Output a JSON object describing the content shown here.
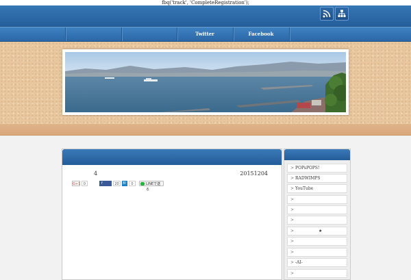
{
  "top_script_text": "fbq('track', 'CompleteRegistration');",
  "header": {
    "icons": [
      "rss-icon",
      "sitemap-icon"
    ]
  },
  "nav": {
    "items": [
      {
        "label": ""
      },
      {
        "label": ""
      },
      {
        "label": ""
      },
      {
        "label": "Twitter"
      },
      {
        "label": "Facebook"
      }
    ]
  },
  "banner": {
    "icon": "seaside-photo"
  },
  "post": {
    "title": "4",
    "date": "20151204",
    "social": {
      "gplus_label": "G+1",
      "gplus_count": "0",
      "fb_label": "f",
      "fb_count": "20",
      "hatena_label": "B!",
      "hatena_count": "0",
      "line_label": "LINEで送る"
    }
  },
  "sidebar": {
    "items": [
      {
        "label": "POPsPOPS!"
      },
      {
        "label": "RADWIMPS"
      },
      {
        "label": "YouTube"
      },
      {
        "label": ""
      },
      {
        "label": ""
      },
      {
        "label": ""
      },
      {
        "label": "★"
      },
      {
        "label": ""
      },
      {
        "label": ""
      },
      {
        "label": "-AI-"
      },
      {
        "label": ""
      }
    ],
    "marker": ">"
  },
  "colors": {
    "header_blue": "#2d6aa8",
    "sand": "#e8c79f",
    "accent_green": "#27b43a"
  }
}
